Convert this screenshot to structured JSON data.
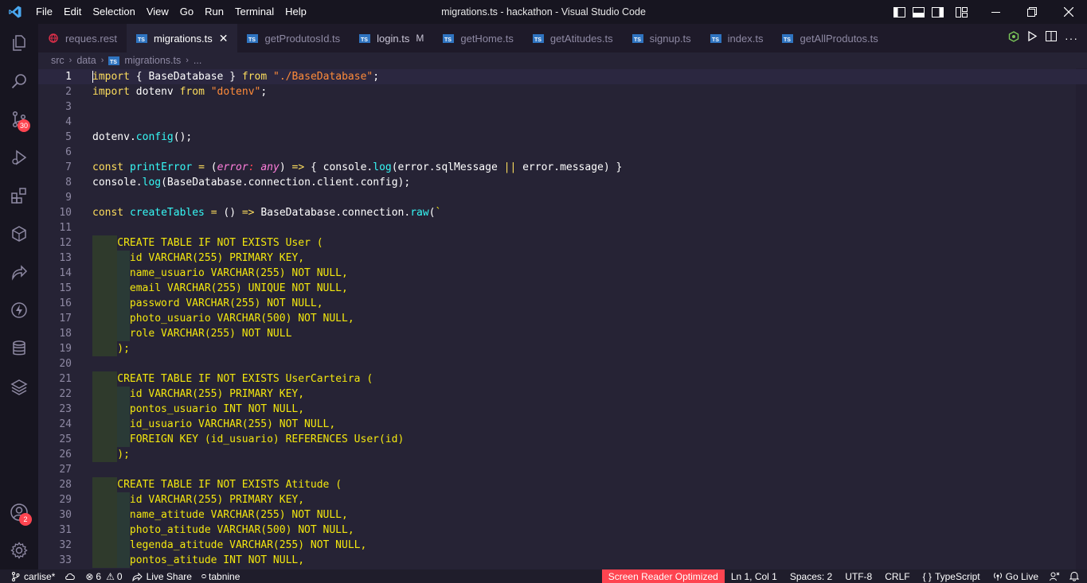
{
  "window": {
    "title": "migrations.ts - hackathon - Visual Studio Code",
    "menu": [
      "File",
      "Edit",
      "Selection",
      "View",
      "Go",
      "Run",
      "Terminal",
      "Help"
    ]
  },
  "activity_bar": {
    "source_control_badge": "30",
    "accounts_badge": "2"
  },
  "tabs": [
    {
      "label": "reques.rest",
      "icon": "globe-icon",
      "active": false
    },
    {
      "label": "migrations.ts",
      "icon": "ts-icon",
      "active": true
    },
    {
      "label": "getProdutosId.ts",
      "icon": "ts-icon",
      "active": false
    },
    {
      "label": "login.ts",
      "icon": "ts-icon",
      "active": false,
      "modified": "M"
    },
    {
      "label": "getHome.ts",
      "icon": "ts-icon",
      "active": false
    },
    {
      "label": "getAtitudes.ts",
      "icon": "ts-icon",
      "active": false
    },
    {
      "label": "signup.ts",
      "icon": "ts-icon",
      "active": false
    },
    {
      "label": "index.ts",
      "icon": "ts-icon",
      "active": false
    },
    {
      "label": "getAllProdutos.ts",
      "icon": "ts-icon",
      "active": false
    }
  ],
  "breadcrumb": {
    "parts": [
      "src",
      "data",
      "migrations.ts",
      "..."
    ]
  },
  "editor": {
    "lines": [
      {
        "n": "1",
        "tokens": [
          [
            "kw",
            "import"
          ],
          [
            "id",
            " { BaseDatabase } "
          ],
          [
            "kw",
            "from"
          ],
          [
            "id",
            " "
          ],
          [
            "str",
            "\"./BaseDatabase\""
          ],
          [
            "id",
            ";"
          ]
        ]
      },
      {
        "n": "2",
        "tokens": [
          [
            "kw",
            "import"
          ],
          [
            "id",
            " dotenv "
          ],
          [
            "kw",
            "from"
          ],
          [
            "id",
            " "
          ],
          [
            "str",
            "\"dotenv\""
          ],
          [
            "id",
            ";"
          ]
        ]
      },
      {
        "n": "3",
        "tokens": []
      },
      {
        "n": "4",
        "tokens": []
      },
      {
        "n": "5",
        "tokens": [
          [
            "id",
            "dotenv."
          ],
          [
            "fn",
            "config"
          ],
          [
            "id",
            "();"
          ]
        ]
      },
      {
        "n": "6",
        "tokens": []
      },
      {
        "n": "7",
        "tokens": [
          [
            "kw",
            "const"
          ],
          [
            "id",
            " "
          ],
          [
            "fn",
            "printError"
          ],
          [
            "id",
            " "
          ],
          [
            "op",
            "="
          ],
          [
            "id",
            " ("
          ],
          [
            "param",
            "error"
          ],
          [
            "type",
            ":"
          ],
          [
            "id",
            " "
          ],
          [
            "param",
            "any"
          ],
          [
            "id",
            ") "
          ],
          [
            "op",
            "=>"
          ],
          [
            "id",
            " { console."
          ],
          [
            "fn",
            "log"
          ],
          [
            "id",
            "(error.sqlMessage "
          ],
          [
            "op",
            "||"
          ],
          [
            "id",
            " error.message) }"
          ]
        ]
      },
      {
        "n": "8",
        "tokens": [
          [
            "id",
            "console."
          ],
          [
            "fn",
            "log"
          ],
          [
            "id",
            "(BaseDatabase.connection.client.config);"
          ]
        ]
      },
      {
        "n": "9",
        "tokens": []
      },
      {
        "n": "10",
        "tokens": [
          [
            "kw",
            "const"
          ],
          [
            "id",
            " "
          ],
          [
            "fn",
            "createTables"
          ],
          [
            "id",
            " "
          ],
          [
            "op",
            "="
          ],
          [
            "id",
            " () "
          ],
          [
            "op",
            "=>"
          ],
          [
            "id",
            " BaseDatabase.connection."
          ],
          [
            "fn",
            "raw"
          ],
          [
            "id",
            "("
          ],
          [
            "tmpl",
            "`"
          ]
        ]
      },
      {
        "n": "11",
        "tokens": []
      },
      {
        "n": "12",
        "indent": 1,
        "tokens": [
          [
            "tmpl",
            "CREATE TABLE IF NOT EXISTS User ("
          ]
        ]
      },
      {
        "n": "13",
        "indent": 2,
        "tokens": [
          [
            "tmpl",
            "id VARCHAR(255) PRIMARY KEY,"
          ]
        ]
      },
      {
        "n": "14",
        "indent": 2,
        "tokens": [
          [
            "tmpl",
            "name_usuario VARCHAR(255) NOT NULL,"
          ]
        ]
      },
      {
        "n": "15",
        "indent": 2,
        "tokens": [
          [
            "tmpl",
            "email VARCHAR(255) UNIQUE NOT NULL,"
          ]
        ]
      },
      {
        "n": "16",
        "indent": 2,
        "tokens": [
          [
            "tmpl",
            "password VARCHAR(255) NOT NULL,"
          ]
        ]
      },
      {
        "n": "17",
        "indent": 2,
        "tokens": [
          [
            "tmpl",
            "photo_usuario VARCHAR(500) NOT NULL,"
          ]
        ]
      },
      {
        "n": "18",
        "indent": 2,
        "tokens": [
          [
            "tmpl",
            "role VARCHAR(255) NOT NULL"
          ]
        ]
      },
      {
        "n": "19",
        "indent": 1,
        "tokens": [
          [
            "tmpl",
            ");"
          ]
        ]
      },
      {
        "n": "20",
        "tokens": []
      },
      {
        "n": "21",
        "indent": 1,
        "tokens": [
          [
            "tmpl",
            "CREATE TABLE IF NOT EXISTS UserCarteira ("
          ]
        ]
      },
      {
        "n": "22",
        "indent": 2,
        "tokens": [
          [
            "tmpl",
            "id VARCHAR(255) PRIMARY KEY,"
          ]
        ]
      },
      {
        "n": "23",
        "indent": 2,
        "tokens": [
          [
            "tmpl",
            "pontos_usuario INT NOT NULL,"
          ]
        ]
      },
      {
        "n": "24",
        "indent": 2,
        "tokens": [
          [
            "tmpl",
            "id_usuario VARCHAR(255) NOT NULL,"
          ]
        ]
      },
      {
        "n": "25",
        "indent": 2,
        "tokens": [
          [
            "tmpl",
            "FOREIGN KEY (id_usuario) REFERENCES User(id)"
          ]
        ]
      },
      {
        "n": "26",
        "indent": 1,
        "tokens": [
          [
            "tmpl",
            ");"
          ]
        ]
      },
      {
        "n": "27",
        "tokens": []
      },
      {
        "n": "28",
        "indent": 1,
        "tokens": [
          [
            "tmpl",
            "CREATE TABLE IF NOT EXISTS Atitude ("
          ]
        ]
      },
      {
        "n": "29",
        "indent": 2,
        "tokens": [
          [
            "tmpl",
            "id VARCHAR(255) PRIMARY KEY,"
          ]
        ]
      },
      {
        "n": "30",
        "indent": 2,
        "tokens": [
          [
            "tmpl",
            "name_atitude VARCHAR(255) NOT NULL,"
          ]
        ]
      },
      {
        "n": "31",
        "indent": 2,
        "tokens": [
          [
            "tmpl",
            "photo_atitude VARCHAR(500) NOT NULL,"
          ]
        ]
      },
      {
        "n": "32",
        "indent": 2,
        "tokens": [
          [
            "tmpl",
            "legenda_atitude VARCHAR(255) NOT NULL,"
          ]
        ]
      },
      {
        "n": "33",
        "indent": 2,
        "tokens": [
          [
            "tmpl",
            "pontos_atitude INT NOT NULL,"
          ]
        ]
      }
    ]
  },
  "statusbar": {
    "branch": "carlise*",
    "errors": "6",
    "warnings": "0",
    "live_share": "Live Share",
    "tabnine": "tabnine",
    "screen_reader": "Screen Reader Optimized",
    "position": "Ln 1, Col 1",
    "spaces": "Spaces: 2",
    "encoding": "UTF-8",
    "eol": "CRLF",
    "language": "TypeScript",
    "go_live": "Go Live"
  }
}
